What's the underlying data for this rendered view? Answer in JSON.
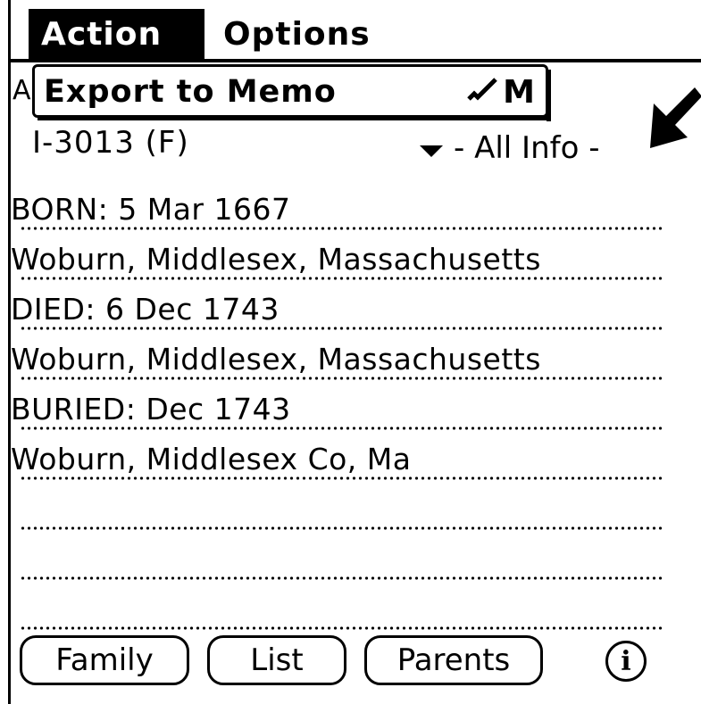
{
  "menubar": {
    "items": [
      {
        "label": "Action",
        "selected": true
      },
      {
        "label": "Options",
        "selected": false
      }
    ]
  },
  "dropdown": {
    "items": [
      {
        "label": "Export to Memo",
        "shortcut": "M",
        "shortcut_icon": "command-stroke-icon"
      }
    ]
  },
  "peek_text": "A",
  "record": {
    "id": "I-3013 (F)",
    "view_select": "- All Info -"
  },
  "lines": [
    "BORN: 5 Mar 1667",
    "Woburn, Middlesex, Massachusetts",
    "DIED: 6 Dec 1743",
    "Woburn, Middlesex, Massachusetts",
    "BURIED: Dec 1743",
    "Woburn, Middlesex Co, Ma",
    "",
    "",
    ""
  ],
  "buttons": {
    "family": "Family",
    "list": "List",
    "parents": "Parents"
  },
  "info_icon": "info-icon",
  "colors": {
    "ink": "#000000",
    "paper": "#ffffff"
  }
}
